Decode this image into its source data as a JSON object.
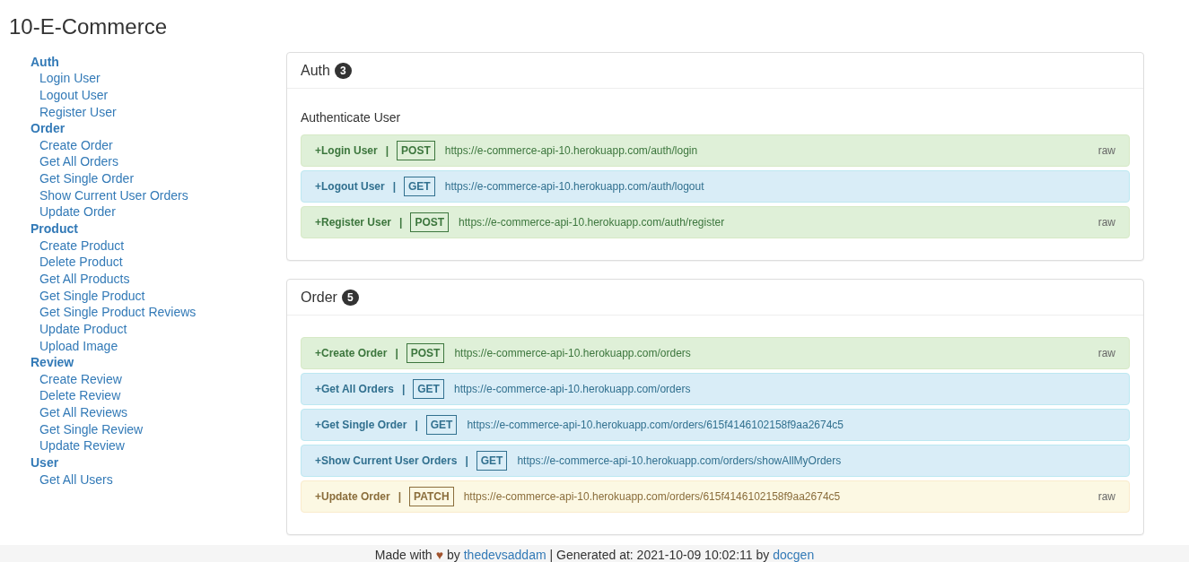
{
  "title": "10-E-Commerce",
  "sidebar": [
    {
      "label": "Auth",
      "items": [
        "Login User",
        "Logout User",
        "Register User"
      ]
    },
    {
      "label": "Order",
      "items": [
        "Create Order",
        "Get All Orders",
        "Get Single Order",
        "Show Current User Orders",
        "Update Order"
      ]
    },
    {
      "label": "Product",
      "items": [
        "Create Product",
        "Delete Product",
        "Get All Products",
        "Get Single Product",
        "Get Single Product Reviews",
        "Update Product",
        "Upload Image"
      ]
    },
    {
      "label": "Review",
      "items": [
        "Create Review",
        "Delete Review",
        "Get All Reviews",
        "Get Single Review",
        "Update Review"
      ]
    },
    {
      "label": "User",
      "items": [
        "Get All Users"
      ]
    }
  ],
  "panels": [
    {
      "title": "Auth",
      "count": "3",
      "description": "Authenticate User",
      "endpoints": [
        {
          "name": "+Login User",
          "separator": "|",
          "method": "POST",
          "url": "https://e-commerce-api-10.herokuapp.com/auth/login",
          "raw": "raw"
        },
        {
          "name": "+Logout User",
          "separator": "|",
          "method": "GET",
          "url": "https://e-commerce-api-10.herokuapp.com/auth/logout"
        },
        {
          "name": "+Register User",
          "separator": "|",
          "method": "POST",
          "url": "https://e-commerce-api-10.herokuapp.com/auth/register",
          "raw": "raw"
        }
      ]
    },
    {
      "title": "Order",
      "count": "5",
      "endpoints": [
        {
          "name": "+Create Order",
          "separator": "|",
          "method": "POST",
          "url": "https://e-commerce-api-10.herokuapp.com/orders",
          "raw": "raw"
        },
        {
          "name": "+Get All Orders",
          "separator": "|",
          "method": "GET",
          "url": "https://e-commerce-api-10.herokuapp.com/orders"
        },
        {
          "name": "+Get Single Order",
          "separator": "|",
          "method": "GET",
          "url": "https://e-commerce-api-10.herokuapp.com/orders/615f4146102158f9aa2674c5"
        },
        {
          "name": "+Show Current User Orders",
          "separator": "|",
          "method": "GET",
          "url": "https://e-commerce-api-10.herokuapp.com/orders/showAllMyOrders"
        },
        {
          "name": "+Update Order",
          "separator": "|",
          "method": "PATCH",
          "url": "https://e-commerce-api-10.herokuapp.com/orders/615f4146102158f9aa2674c5",
          "raw": "raw"
        }
      ]
    }
  ],
  "footer": {
    "made_with": "Made with",
    "heart": "♥",
    "by": "by",
    "author": "thedevsaddam",
    "generated": "| Generated at: 2021-10-09 10:02:11 by",
    "tool": "docgen"
  }
}
